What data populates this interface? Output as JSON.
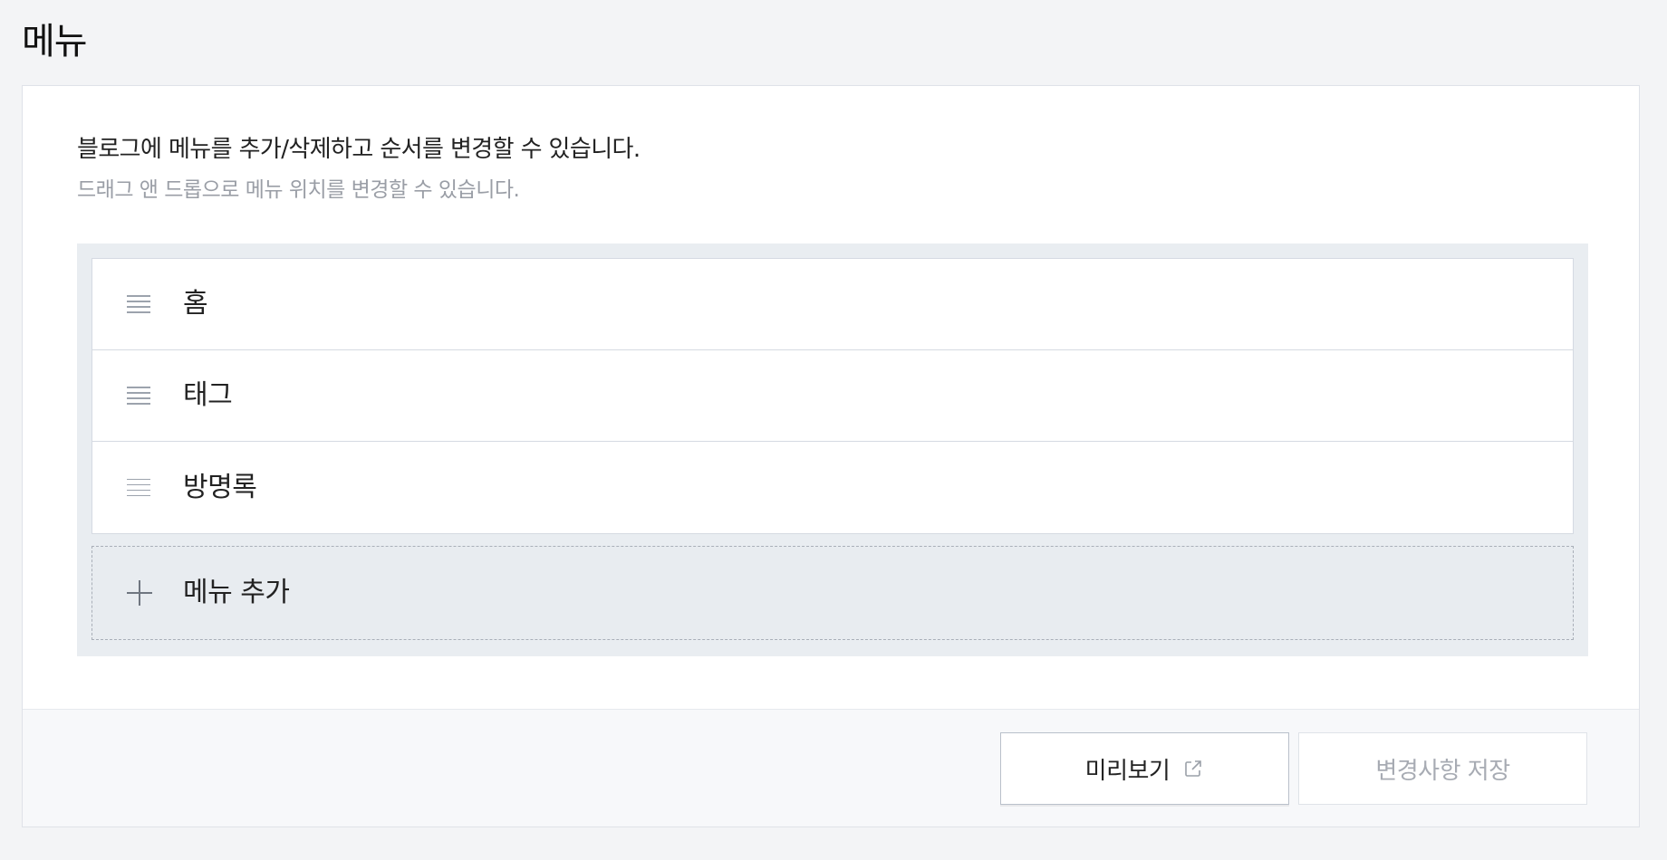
{
  "page": {
    "title": "메뉴"
  },
  "description": {
    "main": "블로그에 메뉴를 추가/삭제하고 순서를 변경할 수 있습니다.",
    "sub": "드래그 앤 드롭으로 메뉴 위치를 변경할 수 있습니다."
  },
  "menu": {
    "items": [
      {
        "label": "홈",
        "icon": "drag-handle-icon"
      },
      {
        "label": "태그",
        "icon": "drag-handle-icon"
      },
      {
        "label": "방명록",
        "icon": "drag-handle-icon"
      }
    ],
    "add_label": "메뉴 추가",
    "add_icon": "plus-icon"
  },
  "footer": {
    "preview_label": "미리보기",
    "preview_icon": "external-link-icon",
    "save_label": "변경사항 저장"
  },
  "colors": {
    "page_background": "#f3f4f6",
    "card_background": "#ffffff",
    "menu_area_background": "#e9edf1",
    "border": "#d5dae2",
    "muted_text": "#9a9ea6",
    "disabled_text": "#a7abb3"
  }
}
